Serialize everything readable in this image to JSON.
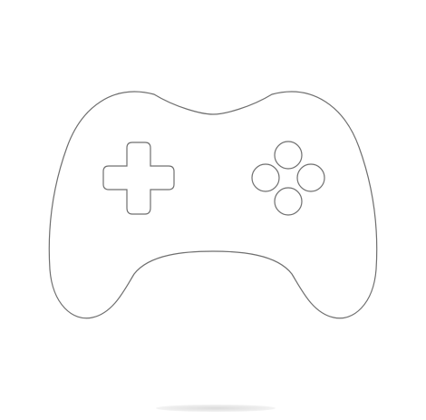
{
  "image": {
    "icon": "gamepad-icon",
    "parts": [
      "dpad-icon",
      "face-button-icon"
    ],
    "colors": {
      "background": "#ffffff",
      "outline": "#6f6f6f",
      "shadow": "#d9d9d9"
    }
  }
}
